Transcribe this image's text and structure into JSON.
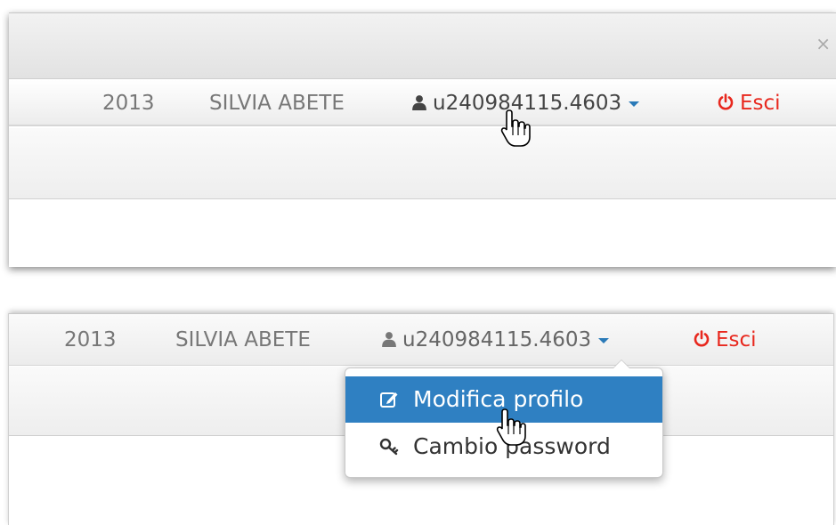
{
  "panels": [
    {
      "year": "2013",
      "user_name": "SILVIA ABETE",
      "username": "u240984115.4603",
      "logout_label": "Esci",
      "close_symbol": "×"
    },
    {
      "year": "2013",
      "user_name": "SILVIA ABETE",
      "username": "u240984115.4603",
      "logout_label": "Esci",
      "dropdown": {
        "items": [
          {
            "label": "Modifica profilo",
            "icon": "edit-icon",
            "active": true
          },
          {
            "label": "Cambio password",
            "icon": "key-icon",
            "active": false
          }
        ]
      }
    }
  ],
  "colors": {
    "accent": "#2f80c2",
    "logout": "#e8281e",
    "caret": "#2a7ab8"
  }
}
